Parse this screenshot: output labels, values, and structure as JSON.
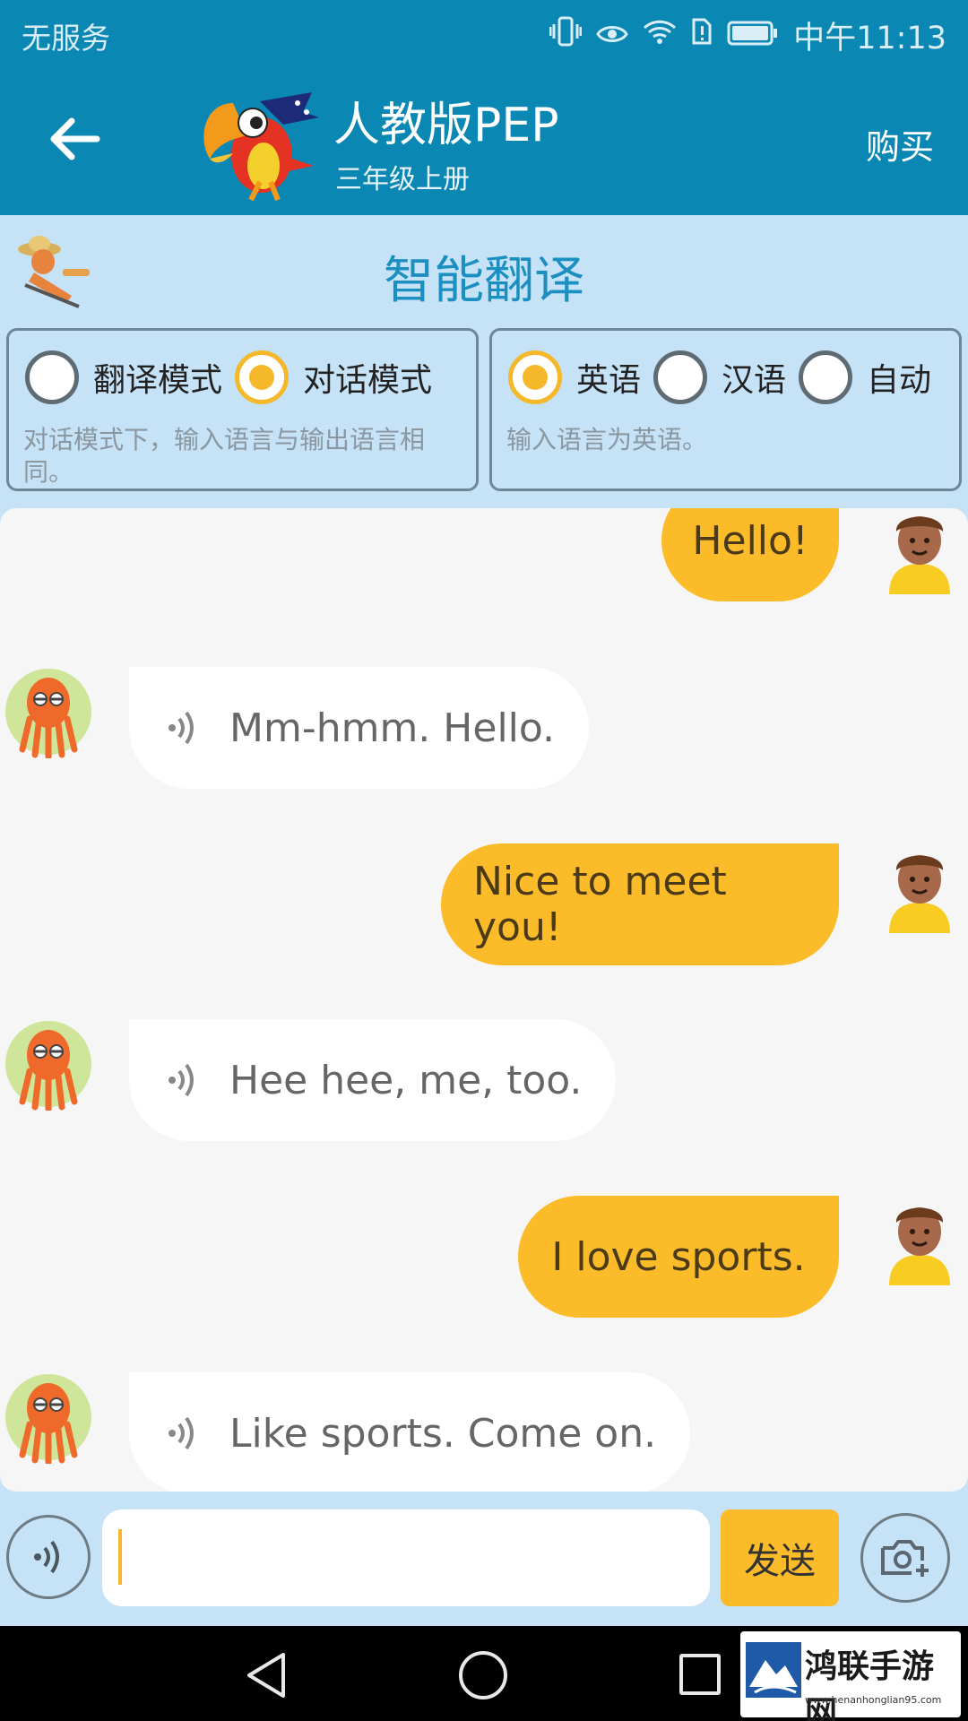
{
  "status_bar": {
    "carrier": "无服务",
    "time": "中午11:13",
    "icons": [
      "vibrate-icon",
      "eye-icon",
      "wifi-icon",
      "sim-alert-icon",
      "battery-icon"
    ]
  },
  "header": {
    "title": "人教版PEP",
    "subtitle": "三年级上册",
    "buy_label": "购买",
    "back_icon": "back-arrow-icon",
    "mascot_icon": "parrot-mascot-icon"
  },
  "section": {
    "title": "智能翻译",
    "icon": "lazy-character-icon"
  },
  "mode_options": {
    "items": [
      {
        "label": "翻译模式",
        "selected": false
      },
      {
        "label": "对话模式",
        "selected": true
      }
    ],
    "hint": "对话模式下，输入语言与输出语言相同。"
  },
  "language_options": {
    "items": [
      {
        "label": "英语",
        "selected": true
      },
      {
        "label": "汉语",
        "selected": false
      },
      {
        "label": "自动",
        "selected": false
      }
    ],
    "hint": "输入语言为英语。"
  },
  "messages": [
    {
      "from": "me",
      "text": "Hello!"
    },
    {
      "from": "bot",
      "text": "Mm-hmm. Hello."
    },
    {
      "from": "me",
      "text": "Nice to meet you!"
    },
    {
      "from": "bot",
      "text": "Hee hee, me, too."
    },
    {
      "from": "me",
      "text": "I love sports."
    },
    {
      "from": "bot",
      "text": "Like sports. Come on."
    }
  ],
  "input_bar": {
    "value": "",
    "send_label": "发送",
    "voice_icon": "voice-input-icon",
    "camera_icon": "camera-add-icon"
  },
  "nav_bar": {
    "icons": [
      "nav-back-icon",
      "nav-home-icon",
      "nav-recent-icon"
    ]
  },
  "watermark": {
    "title": "鸿联手游网",
    "url": "www.henanhonglian95.com"
  },
  "colors": {
    "header": "#0a87b3",
    "background": "#c6e2f7",
    "accent": "#fcbb29",
    "section_title": "#1a8fc0"
  }
}
